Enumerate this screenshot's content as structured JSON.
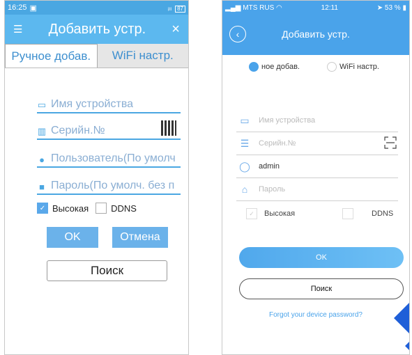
{
  "left": {
    "status": {
      "time": "16:25",
      "signal": "ᵢₗₗ",
      "battery": "87"
    },
    "header": {
      "title": "Добавить устр.",
      "close": "×"
    },
    "tabs": [
      "Ручное добав.",
      "WiFi настр."
    ],
    "fields": {
      "device_name": "Имя устройства",
      "serial": "Серийн.№",
      "user": "Пользователь(По умолч",
      "password": "Пароль(По умолч. без п"
    },
    "checks": {
      "high": "Высокая",
      "ddns": "DDNS"
    },
    "buttons": {
      "ok": "OK",
      "cancel": "Отмена",
      "search": "Поиск"
    }
  },
  "right": {
    "status": {
      "carrier": "MTS RUS",
      "time": "12:11",
      "battery": "53 %"
    },
    "title": "Добавить устр.",
    "radios": {
      "manual": "ное добав.",
      "wifi": "WiFi настр."
    },
    "fields": {
      "device_name": "Имя устройства",
      "serial": "Серийн.№",
      "user": "admin",
      "password": "Пароль"
    },
    "checks": {
      "high": "Высокая",
      "ddns": "DDNS"
    },
    "buttons": {
      "ok": "OK",
      "search": "Поиск"
    },
    "forgot": "Forgot your device password?"
  },
  "colors": {
    "accent": "#4aa3ea",
    "header_left": "#5cb8ef"
  }
}
